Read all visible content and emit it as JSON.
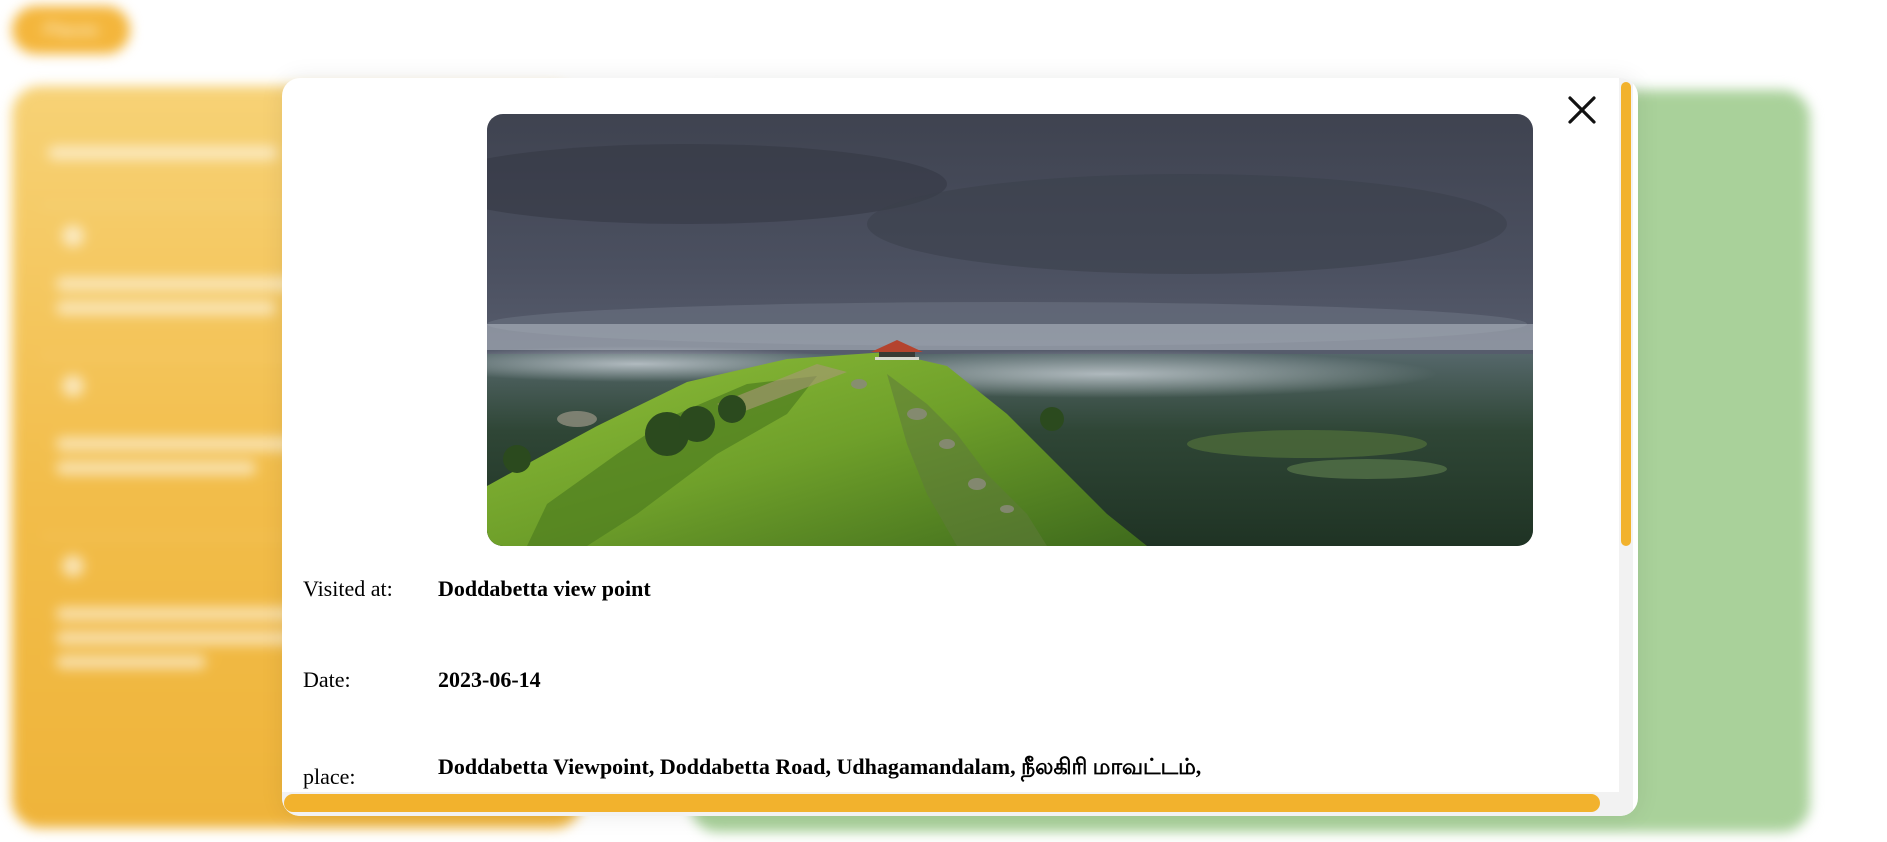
{
  "background": {
    "pill_label": "Places",
    "accent_color": "#f2b22d",
    "left_panel_color": "#f2bd4a",
    "right_panel_color": "#a9d19a"
  },
  "modal": {
    "close_icon": "close-icon",
    "image_alt": "Doddabetta view point – hilltop with viewing pavilion under cloudy sky",
    "details": [
      {
        "label": "Visited at:",
        "value": "Doddabetta view point"
      },
      {
        "label": "Date:",
        "value": "2023-06-14"
      },
      {
        "label": "place:",
        "value": "Doddabetta Viewpoint, Doddabetta Road, Udhagamandalam, நீலகிரி மாவட்டம்,"
      }
    ]
  }
}
